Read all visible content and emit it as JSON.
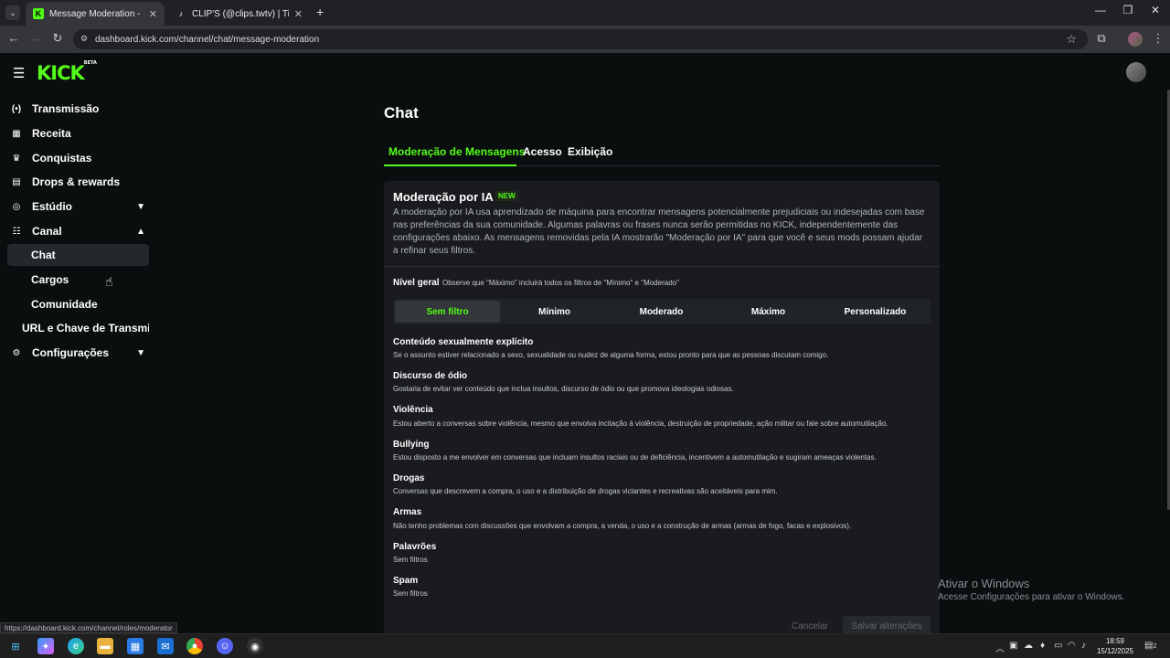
{
  "browser": {
    "tabs": [
      {
        "title": "Message Moderation - Kick Da",
        "favicon": "kick-icon"
      },
      {
        "title": "CLIP'S (@clips.twtv) | TikTok",
        "favicon": "tiktok-icon"
      }
    ],
    "new_tab": "+",
    "url": "dashboard.kick.com/channel/chat/message-moderation",
    "status_url": "https://dashboard.kick.com/channel/roles/moderator"
  },
  "sidebar": {
    "items": [
      {
        "label": "Transmissão",
        "icon": "broadcast-icon"
      },
      {
        "label": "Receita",
        "icon": "chart-icon"
      },
      {
        "label": "Conquistas",
        "icon": "trophy-icon"
      },
      {
        "label": "Drops & rewards",
        "icon": "drops-icon"
      },
      {
        "label": "Estúdio",
        "icon": "studio-icon"
      },
      {
        "label": "Canal",
        "icon": "channel-icon"
      },
      {
        "label": "Configurações",
        "icon": "gear-icon"
      }
    ],
    "subitems": [
      "Chat",
      "Cargos",
      "Comunidade",
      "URL e Chave de Transmissã"
    ]
  },
  "main": {
    "title": "Chat",
    "tabs": [
      "Moderação de Mensagens",
      "Acesso",
      "Exibição"
    ],
    "ai": {
      "title": "Moderação por IA",
      "badge": "NEW",
      "description": "A moderação por IA usa aprendizado de máquina para encontrar mensagens potencialmente prejudiciais ou indesejadas com base nas preferências da sua comunidade. Algumas palavras ou frases nunca serão permitidas no KICK, independentemente das configurações abaixo. As mensagens removidas pela IA mostrarão \"Moderação por IA\" para que você e seus mods possam ajudar a refinar seus filtros."
    },
    "nivel": {
      "label": "Nível geral",
      "note": "Observe que \"Máximo\" incluirá todos os filtros de \"Mínimo\" e \"Moderado\"",
      "options": [
        "Sem filtro",
        "Mínimo",
        "Moderado",
        "Máximo",
        "Personalizado"
      ],
      "selected": "Sem filtro"
    },
    "categories": [
      {
        "title": "Conteúdo sexualmente explícito",
        "desc": "Se o assunto estiver relacionado a sexo, sexualidade ou nudez de alguma forma, estou pronto para que as pessoas discutam comigo."
      },
      {
        "title": "Discurso de ódio",
        "desc": "Gostaria de evitar ver conteúdo que inclua insultos, discurso de ódio ou que promova ideologias odiosas."
      },
      {
        "title": "Violência",
        "desc": "Estou aberto a conversas sobre violência, mesmo que envolva incitação à violência, destruição de propriedade, ação militar ou fale sobre automutilação."
      },
      {
        "title": "Bullying",
        "desc": "Estou disposto a me envolver em conversas que incluam insultos raciais ou de deficiência, incentivem a automutilação e sugiram ameaças violentas."
      },
      {
        "title": "Drogas",
        "desc": "Conversas que descrevem a compra, o uso e a distribuição de drogas viciantes e recreativas são aceitáveis para mim."
      },
      {
        "title": "Armas",
        "desc": "Não tenho problemas com discussões que envolvam a compra, a venda, o uso e a construção de armas (armas de fogo, facas e explosivos)."
      },
      {
        "title": "Palavrões",
        "desc": "Sem filtros"
      },
      {
        "title": "Spam",
        "desc": "Sem filtros"
      }
    ],
    "cancel": "Cancelar",
    "save": "Salvar alterações"
  },
  "watermark": {
    "line1": "Ativar o Windows",
    "line2": "Acesse Configurações para ativar o Windows."
  },
  "taskbar": {
    "time": "18:59",
    "date": "15/12/2025",
    "notifications": "2"
  },
  "colors": {
    "accent": "#53fc18",
    "background": "#0b0e0f",
    "card": "#191b1f"
  }
}
